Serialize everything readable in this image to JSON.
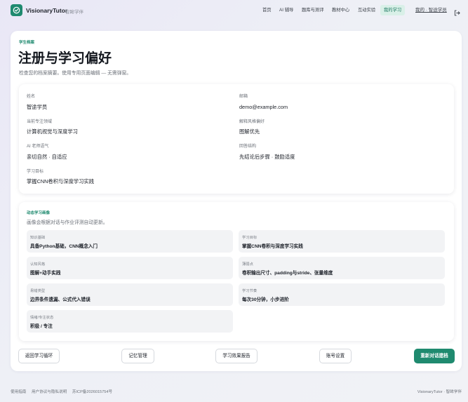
{
  "brand": {
    "name": "VisionaryTutor",
    "subtitle": "智眸学伴"
  },
  "nav": {
    "items": [
      {
        "label": "首页"
      },
      {
        "label": "AI 辅导"
      },
      {
        "label": "题库与测评"
      },
      {
        "label": "教材中心"
      },
      {
        "label": "互动实验"
      },
      {
        "label": "我的学习",
        "active": true
      }
    ],
    "user_link": "我的 · 智途学员"
  },
  "page": {
    "eyebrow": "学生档案",
    "title": "注册与学习偏好",
    "description": "检查您的档案摘要。使用专用页面编辑 — 无需弹窗。"
  },
  "profile": {
    "name_label": "姓名",
    "name_value": "智途学员",
    "email_label": "邮箱",
    "email_value": "demo@example.com",
    "focus_label": "当前专注领域",
    "focus_value": "计算机视觉与深度学习",
    "style_label": "解释风格偏好",
    "style_value": "图解优先",
    "tone_label": "AI 老师语气",
    "tone_value": "亲切自然 · 自适应",
    "structure_label": "回答结构",
    "structure_value": "先结论后步骤 · 鼓励适度",
    "goal_label": "学习目标",
    "goal_value": "掌握CNN卷积与深度学习实践"
  },
  "dynamic": {
    "eyebrow": "动态学习画像",
    "description": "画像会根据对话与作业评测自动更新。",
    "tiles": [
      {
        "label": "知识基础",
        "value": "具备Python基础，CNN概念入门"
      },
      {
        "label": "学习目标",
        "value": "掌握CNN卷积与深度学习实践"
      },
      {
        "label": "认知风格",
        "value": "图解+动手实践"
      },
      {
        "label": "薄弱点",
        "value": "卷积输出尺寸、padding与stride、张量维度"
      },
      {
        "label": "易错类型",
        "value": "边界条件遗漏、公式代入错误"
      },
      {
        "label": "学习节奏",
        "value": "每次30分钟，小步进阶"
      },
      {
        "label": "情绪/专注状态",
        "value": "积极 / 专注"
      }
    ]
  },
  "actions": {
    "back": "返回学习循环",
    "memory": "记忆管理",
    "report": "学习效果报告",
    "account": "账号设置",
    "rebuild": "重新对话建档"
  },
  "footer": {
    "guide": "使用指南",
    "policy": "用户协议与隐私说明",
    "icp": "苏ICP备2026015754号",
    "brand": "VisionaryTutor · 智眸学伴"
  },
  "colors": {
    "accent": "#1f8a6f",
    "active_nav_bg": "#d9f0e8"
  }
}
